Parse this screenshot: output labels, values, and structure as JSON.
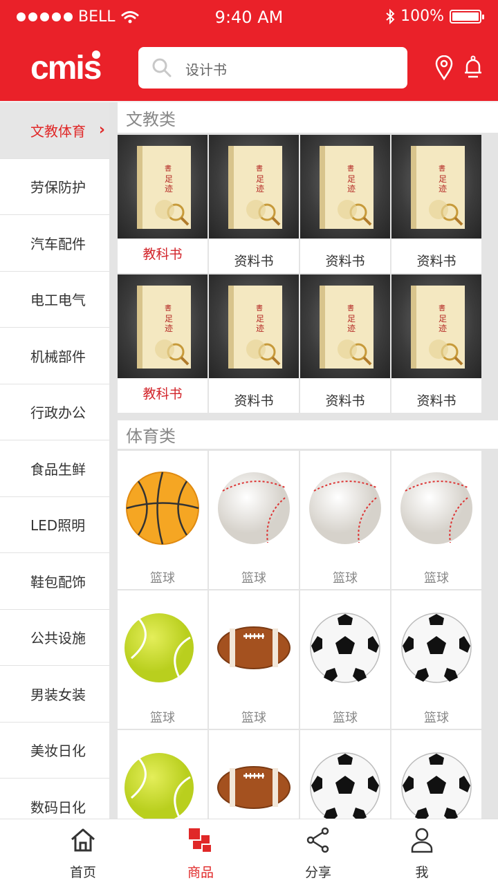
{
  "status_bar": {
    "carrier": "BELL",
    "time": "9:40 AM",
    "battery": "100%"
  },
  "header": {
    "logo": "cmis",
    "search_placeholder": "设计书",
    "location_icon": "location-pin-icon",
    "bell_icon": "bell-icon"
  },
  "colors": {
    "brand_red": "#ea2129",
    "active_text": "#e02828"
  },
  "sidebar": {
    "items": [
      {
        "label": "文教体育",
        "active": true
      },
      {
        "label": "劳保防护"
      },
      {
        "label": "汽车配件"
      },
      {
        "label": "电工电气"
      },
      {
        "label": "机械部件"
      },
      {
        "label": "行政办公"
      },
      {
        "label": "食品生鲜"
      },
      {
        "label": "LED照明"
      },
      {
        "label": "鞋包配饰"
      },
      {
        "label": "公共设施"
      },
      {
        "label": "男装女装"
      },
      {
        "label": "美妆日化"
      },
      {
        "label": "数码日化"
      }
    ]
  },
  "sections": [
    {
      "title": "文教类",
      "products": [
        {
          "label": "教科书",
          "image": "book"
        },
        {
          "label": "资料书",
          "image": "book"
        },
        {
          "label": "资料书",
          "image": "book"
        },
        {
          "label": "资料书",
          "image": "book"
        },
        {
          "label": "教科书",
          "image": "book"
        },
        {
          "label": "资料书",
          "image": "book"
        },
        {
          "label": "资料书",
          "image": "book"
        },
        {
          "label": "资料书",
          "image": "book"
        }
      ]
    },
    {
      "title": "体育类",
      "products": [
        {
          "label": "篮球",
          "image": "basketball"
        },
        {
          "label": "篮球",
          "image": "baseball"
        },
        {
          "label": "篮球",
          "image": "baseball"
        },
        {
          "label": "篮球",
          "image": "baseball"
        },
        {
          "label": "篮球",
          "image": "tennis-ball"
        },
        {
          "label": "篮球",
          "image": "rugby-ball"
        },
        {
          "label": "篮球",
          "image": "soccer-ball"
        },
        {
          "label": "篮球",
          "image": "soccer-ball"
        },
        {
          "label": "",
          "image": "tennis-ball"
        },
        {
          "label": "",
          "image": "rugby-ball"
        },
        {
          "label": "",
          "image": "soccer-ball"
        },
        {
          "label": "",
          "image": "soccer-ball"
        }
      ]
    }
  ],
  "tabbar": {
    "tabs": [
      {
        "label": "首页",
        "icon": "home-icon"
      },
      {
        "label": "商品",
        "icon": "grid-icon",
        "active": true
      },
      {
        "label": "分享",
        "icon": "share-icon"
      },
      {
        "label": "我",
        "icon": "user-icon"
      }
    ]
  }
}
